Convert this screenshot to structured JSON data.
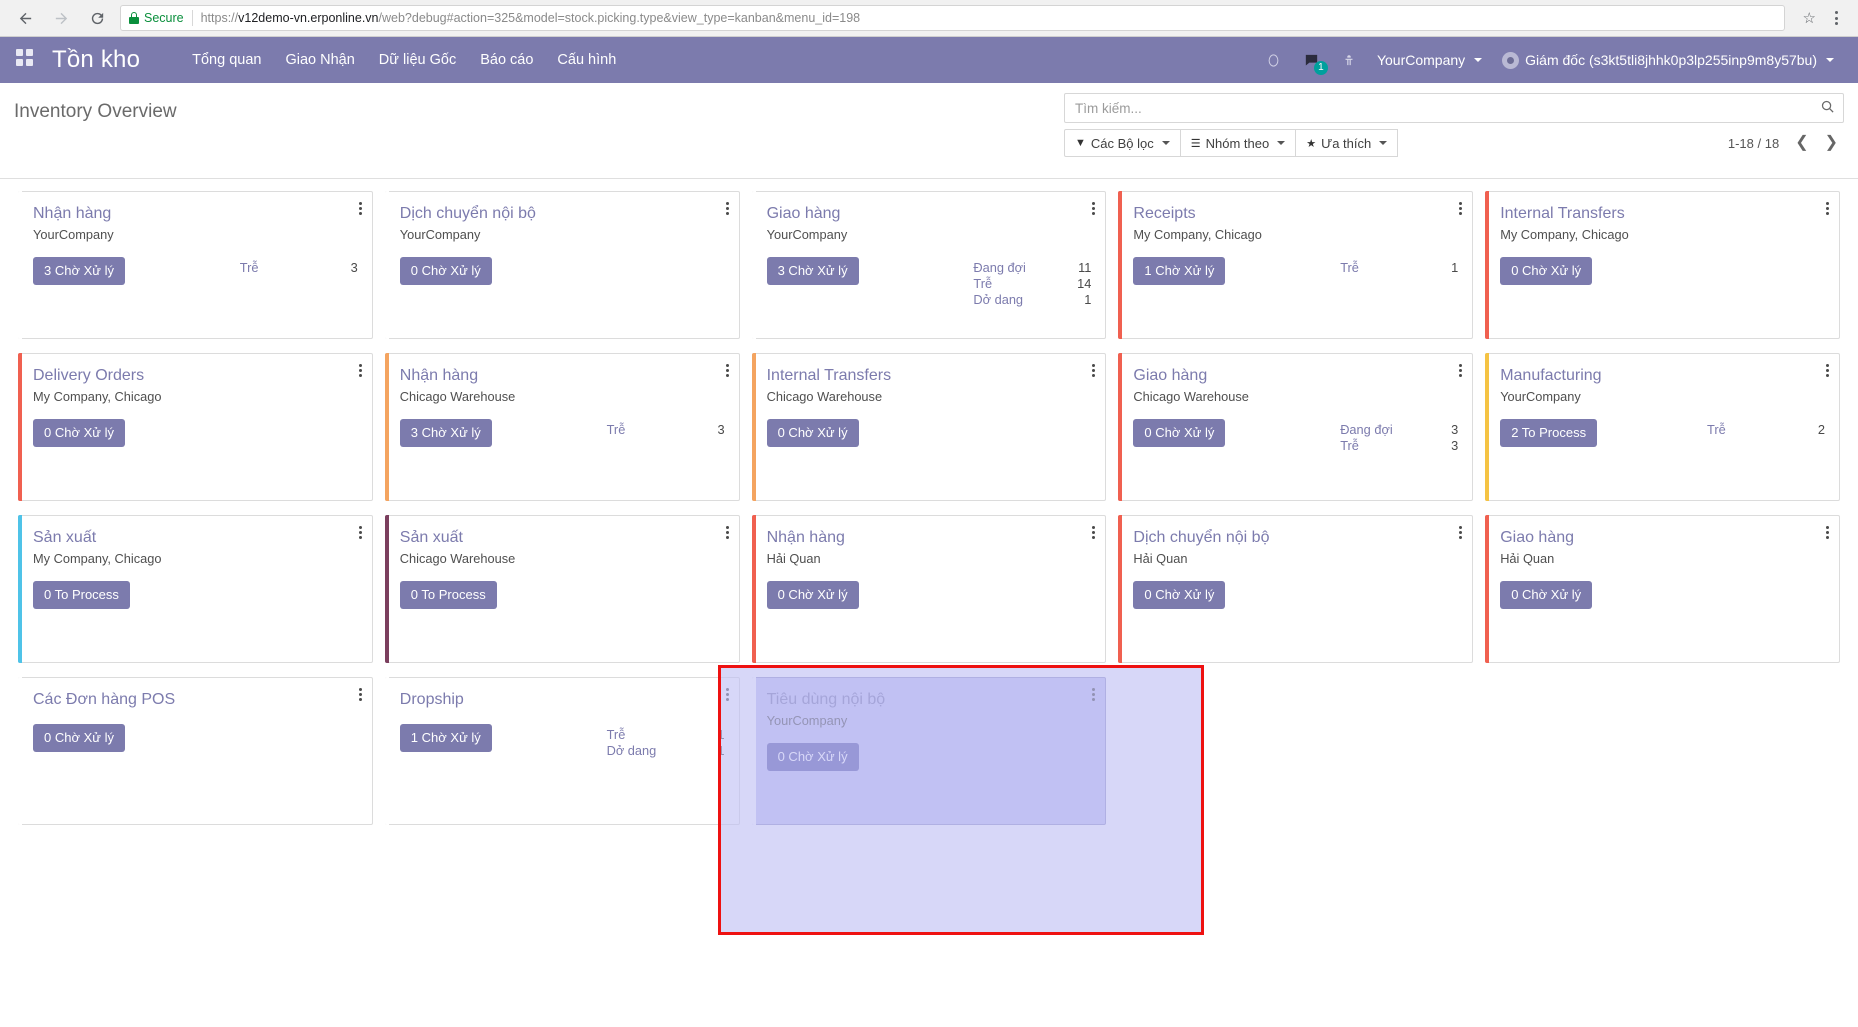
{
  "browser": {
    "back_icon": "back-arrow-icon",
    "forward_icon": "forward-arrow-icon",
    "reload_icon": "reload-icon",
    "secure_label": "Secure",
    "url_scheme": "https://",
    "url_host": "v12demo-vn.erponline.vn",
    "url_path": "/web?debug#action=325&model=stock.picking.type&view_type=kanban&menu_id=198",
    "bookmark_icon": "star-icon",
    "menu_icon": "browser-menu-icon"
  },
  "navbar": {
    "apps_icon": "apps-grid-icon",
    "brand": "Tồn kho",
    "menu": [
      {
        "label": "Tổng quan"
      },
      {
        "label": "Giao Nhận"
      },
      {
        "label": "Dữ liệu Gốc"
      },
      {
        "label": "Báo cáo"
      },
      {
        "label": "Cấu hình"
      }
    ],
    "activities_icon": "clock-icon",
    "messages_icon": "chat-icon",
    "messages_count": "1",
    "debug_icon": "bug-icon",
    "company": "YourCompany",
    "user": "Giám đốc (s3kt5tli8jhhk0p3lp255inp9m8y57bu)",
    "accent_color": "#7c7bad",
    "badge_color": "#00a09d"
  },
  "control_panel": {
    "title": "Inventory Overview",
    "search_placeholder": "Tìm kiếm...",
    "search_value": "",
    "search_icon": "search-icon",
    "filters_label": "Các Bộ lọc",
    "groupby_label": "Nhóm theo",
    "favorites_label": "Ưa thích",
    "pager_text": "1-18 / 18",
    "pager_prev_icon": "chevron-left-icon",
    "pager_next_icon": "chevron-right-icon"
  },
  "kanban": {
    "cards": [
      {
        "title": "Nhận hàng",
        "company": "YourCompany",
        "button": "3 Chờ Xử lý",
        "edge": "#ffffff",
        "stats": [
          {
            "label": "Trễ",
            "value": "3"
          }
        ]
      },
      {
        "title": "Dịch chuyển nội bộ",
        "company": "YourCompany",
        "button": "0 Chờ Xử lý",
        "edge": "#ffffff",
        "stats": []
      },
      {
        "title": "Giao hàng",
        "company": "YourCompany",
        "button": "3 Chờ Xử lý",
        "edge": "#ffffff",
        "stats": [
          {
            "label": "Đang đợi",
            "value": "11"
          },
          {
            "label": "Trễ",
            "value": "14"
          },
          {
            "label": "Dở dang",
            "value": "1"
          }
        ]
      },
      {
        "title": "Receipts",
        "company": "My Company, Chicago",
        "button": "1 Chờ Xử lý",
        "edge": "#f06050",
        "stats": [
          {
            "label": "Trễ",
            "value": "1"
          }
        ]
      },
      {
        "title": "Internal Transfers",
        "company": "My Company, Chicago",
        "button": "0 Chờ Xử lý",
        "edge": "#f06050",
        "stats": []
      },
      {
        "title": "Delivery Orders",
        "company": "My Company, Chicago",
        "button": "0 Chờ Xử lý",
        "edge": "#f06050",
        "stats": []
      },
      {
        "title": "Nhận hàng",
        "company": "Chicago Warehouse",
        "button": "3 Chờ Xử lý",
        "edge": "#f4a460",
        "stats": [
          {
            "label": "Trễ",
            "value": "3"
          }
        ]
      },
      {
        "title": "Internal Transfers",
        "company": "Chicago Warehouse",
        "button": "0 Chờ Xử lý",
        "edge": "#f4a460",
        "stats": []
      },
      {
        "title": "Giao hàng",
        "company": "Chicago Warehouse",
        "button": "0 Chờ Xử lý",
        "edge": "#f06050",
        "stats": [
          {
            "label": "Đang đợi",
            "value": "3"
          },
          {
            "label": "Trễ",
            "value": "3"
          }
        ]
      },
      {
        "title": "Manufacturing",
        "company": "YourCompany",
        "button": "2 To Process",
        "edge": "#f5c343",
        "stats": [
          {
            "label": "Trễ",
            "value": "2"
          }
        ]
      },
      {
        "title": "Sản xuất",
        "company": "My Company, Chicago",
        "button": "0 To Process",
        "edge": "#4fc3e8",
        "stats": []
      },
      {
        "title": "Sản xuất",
        "company": "Chicago Warehouse",
        "button": "0 To Process",
        "edge": "#7b3f5e",
        "stats": []
      },
      {
        "title": "Nhận hàng",
        "company": "Hải Quan",
        "button": "0 Chờ Xử lý",
        "edge": "#f06050",
        "stats": []
      },
      {
        "title": "Dịch chuyển nội bộ",
        "company": "Hải Quan",
        "button": "0 Chờ Xử lý",
        "edge": "#f06050",
        "stats": []
      },
      {
        "title": "Giao hàng",
        "company": "Hải Quan",
        "button": "0 Chờ Xử lý",
        "edge": "#f06050",
        "stats": []
      },
      {
        "title": "Các Đơn hàng POS",
        "company": "",
        "button": "0 Chờ Xử lý",
        "edge": "#ffffff",
        "stats": []
      },
      {
        "title": "Dropship",
        "company": "",
        "button": "1 Chờ Xử lý",
        "edge": "#ffffff",
        "stats": [
          {
            "label": "Trễ",
            "value": "1"
          },
          {
            "label": "Dở dang",
            "value": "1"
          }
        ]
      },
      {
        "title": "Tiêu dùng nội bộ",
        "company": "YourCompany",
        "button": "0 Chờ Xử lý",
        "edge": "#ffffff",
        "stats": [],
        "selected": true
      }
    ]
  },
  "annotation": {
    "color": "#ee1111",
    "highlight_color": "#c5c5f2"
  }
}
